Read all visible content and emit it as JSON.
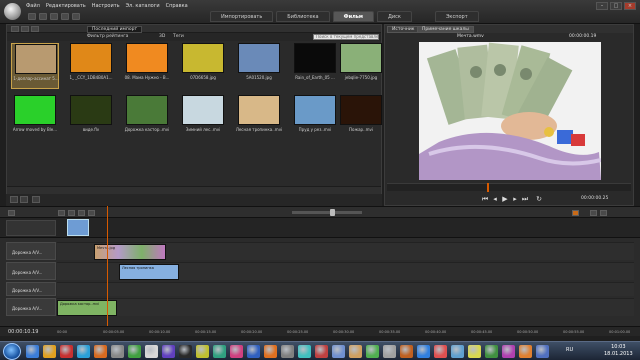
{
  "menu": [
    "Файл",
    "Редактировать",
    "Настроить",
    "Эл. каталоги",
    "Справка"
  ],
  "mode_tabs": [
    "Импортировать",
    "Библиотека",
    "Фильм",
    "Диск",
    "Экспорт"
  ],
  "active_mode": "Фильм",
  "library": {
    "tab": "Последний импорт",
    "filter_label": "Фильтр рейтинга",
    "filter_3d": "3D",
    "filter_tags": "Теги",
    "search_placeholder": "Поиск в текущем представлении",
    "thumbs": [
      {
        "caption": "1-доллар-ассинат 5...",
        "color": "#b89a70",
        "selected": true
      },
      {
        "caption": "1_ _CCY_1DB4B0A1...",
        "color": "#e08818"
      },
      {
        "caption": "08. Мама Нужно - В...",
        "color": "#f08a20"
      },
      {
        "caption": "07D6658.jpg",
        "color": "#c8b830"
      },
      {
        "caption": "5A01520.jpg",
        "color": "#6a8ab8"
      },
      {
        "caption": "Rain_of_Earth_05 ... ",
        "color": "#0a0a0a"
      },
      {
        "caption": "jebqlie-7750.jpg",
        "color": "#8ab078"
      },
      {
        "caption": "Arrow moved by Ble...",
        "color": "#2ad02a"
      },
      {
        "caption": "виде.flv",
        "color": "#2a3a14"
      },
      {
        "caption": "Дорожка кастор..mvi",
        "color": "#4a7a38"
      },
      {
        "caption": "Зимний лес..mvi",
        "color": "#c8d8e0"
      },
      {
        "caption": "Лесная тропинка..mvi",
        "color": "#d8b888"
      },
      {
        "caption": "Пруд у рез..mvi",
        "color": "#6a9ac8"
      },
      {
        "caption": "Пожар..mvi",
        "color": "#2a1408"
      }
    ]
  },
  "preview": {
    "tab_source": "Источник",
    "tab_preview": "Примечание шкалы",
    "title": "Мечта.wmv",
    "timecode": "00:00:00.19",
    "end_timecode": "00:00:00.25"
  },
  "timeline": {
    "tracks": [
      "Дорожка A/V...",
      "Дорожка A/V...",
      "Дорожка A/V...",
      "Дорожка A/V..."
    ],
    "clips": [
      {
        "label": "Мечта.jpg",
        "color": "#6fa3d8"
      },
      {
        "label": "Лесная тропинка",
        "color": "#86b0e0"
      },
      {
        "label": "Дорожка кастор..mvi",
        "color": "#7fb463"
      }
    ],
    "ruler_ticks": [
      "00:00",
      "00:00:05.00",
      "00:00:10.00",
      "00:00:15.00",
      "00:00:20.00",
      "00:00:25.00",
      "00:00:30.00",
      "00:00:35.00",
      "00:00:40.00",
      "00:00:45.00",
      "00:00:50.00",
      "00:00:55.00",
      "00:01:00.00"
    ],
    "timecode": "00:00:10.19"
  },
  "taskbar": {
    "lang": "RU",
    "time": "10:03",
    "date": "18.01.2013"
  },
  "colors": {
    "accent": "#d85a00",
    "selected_thumb": "#c8a24a"
  }
}
